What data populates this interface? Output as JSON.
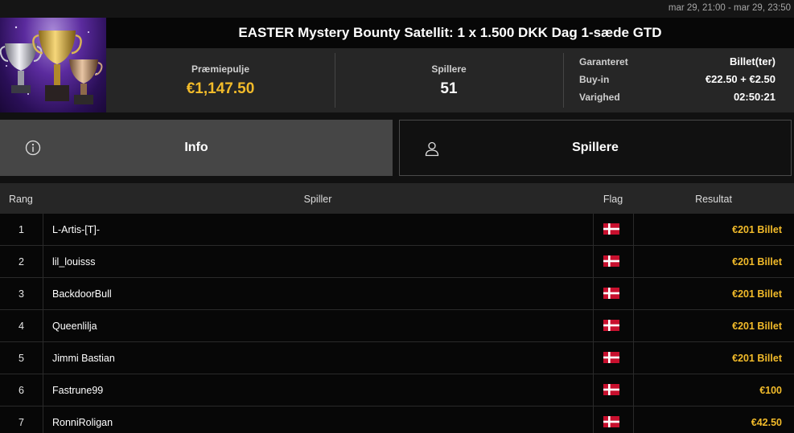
{
  "header": {
    "date_range": "mar 29, 21:00 - mar 29, 23:50",
    "title": "EASTER Mystery Bounty Satellit: 1 x 1.500 DKK Dag 1-sæde GTD",
    "thumbnail_icon": "trophy-cups-image"
  },
  "stats": {
    "prize_pool_label": "Præmiepulje",
    "prize_pool_value": "€1,147.50",
    "players_label": "Spillere",
    "players_value": "51"
  },
  "details": [
    {
      "label": "Garanteret",
      "value": "Billet(ter)"
    },
    {
      "label": "Buy-in",
      "value": "€22.50 + €2.50"
    },
    {
      "label": "Varighed",
      "value": "02:50:21"
    }
  ],
  "tabs": [
    {
      "label": "Info",
      "icon": "info-circle-icon",
      "active": true
    },
    {
      "label": "Spillere",
      "icon": "user-icon",
      "active": false
    }
  ],
  "table": {
    "columns": [
      "Rang",
      "Spiller",
      "Flag",
      "Resultat"
    ],
    "rows": [
      {
        "rank": "1",
        "player": "L-Artis-[T]-",
        "flag": "denmark-flag-icon",
        "result": "€201 Billet"
      },
      {
        "rank": "2",
        "player": "lil_louisss",
        "flag": "denmark-flag-icon",
        "result": "€201 Billet"
      },
      {
        "rank": "3",
        "player": "BackdoorBull",
        "flag": "denmark-flag-icon",
        "result": "€201 Billet"
      },
      {
        "rank": "4",
        "player": "Queenlilja",
        "flag": "denmark-flag-icon",
        "result": "€201 Billet"
      },
      {
        "rank": "5",
        "player": "Jimmi Bastian",
        "flag": "denmark-flag-icon",
        "result": "€201 Billet"
      },
      {
        "rank": "6",
        "player": "Fastrune99",
        "flag": "denmark-flag-icon",
        "result": "€100"
      },
      {
        "rank": "7",
        "player": "RonniRoligan",
        "flag": "denmark-flag-icon",
        "result": "€42.50"
      }
    ]
  },
  "colors": {
    "accent_gold": "#f2bb2a",
    "background": "#111111",
    "panel": "#262626",
    "active_tab": "#464646",
    "denmark_red": "#c8102e"
  }
}
